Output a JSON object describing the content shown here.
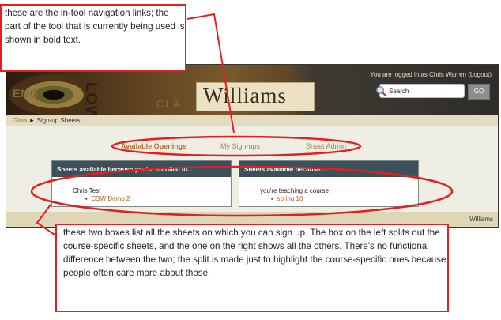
{
  "header": {
    "banner_eye_text": "ENG",
    "banner_low_text": "LOW",
    "banner_cla_text": "CLA",
    "logo": "Williams",
    "login_status": "You are logged in as Chris Warren (Logout)",
    "search_placeholder": "Search",
    "go_label": "GO"
  },
  "breadcrumb": {
    "root": "Glow",
    "separator": "►",
    "current": "Sign-up Sheets"
  },
  "tabs": [
    {
      "label": "Available Openings",
      "active": true
    },
    {
      "label": "My Sign-ups",
      "active": false
    },
    {
      "label": "Sheet Admin",
      "active": false
    }
  ],
  "panels": {
    "left": {
      "title": "Sheets available because you're enrolled in...",
      "group": "Chris Test",
      "items": [
        "CSW Demo 2"
      ]
    },
    "right": {
      "title": "Sheets available because...",
      "group": "you're teaching a course",
      "items": [
        "spring 10"
      ]
    }
  },
  "footer": {
    "text": "Williams"
  },
  "callouts": {
    "top": "these are the in-tool navigation links; the part of the tool that is currently being used is shown in bold text.",
    "bottom": "these two boxes list all the sheets on which you can sign up. The box on the left splits out the course-specific sheets, and the one on the right shows all the others. There's no functional difference between the two; the split is made just to highlight the course-specific ones because people often care more about those."
  },
  "colors": {
    "annotation": "#e22020",
    "panel_header": "#3d4f58",
    "link": "#b87a3a"
  }
}
